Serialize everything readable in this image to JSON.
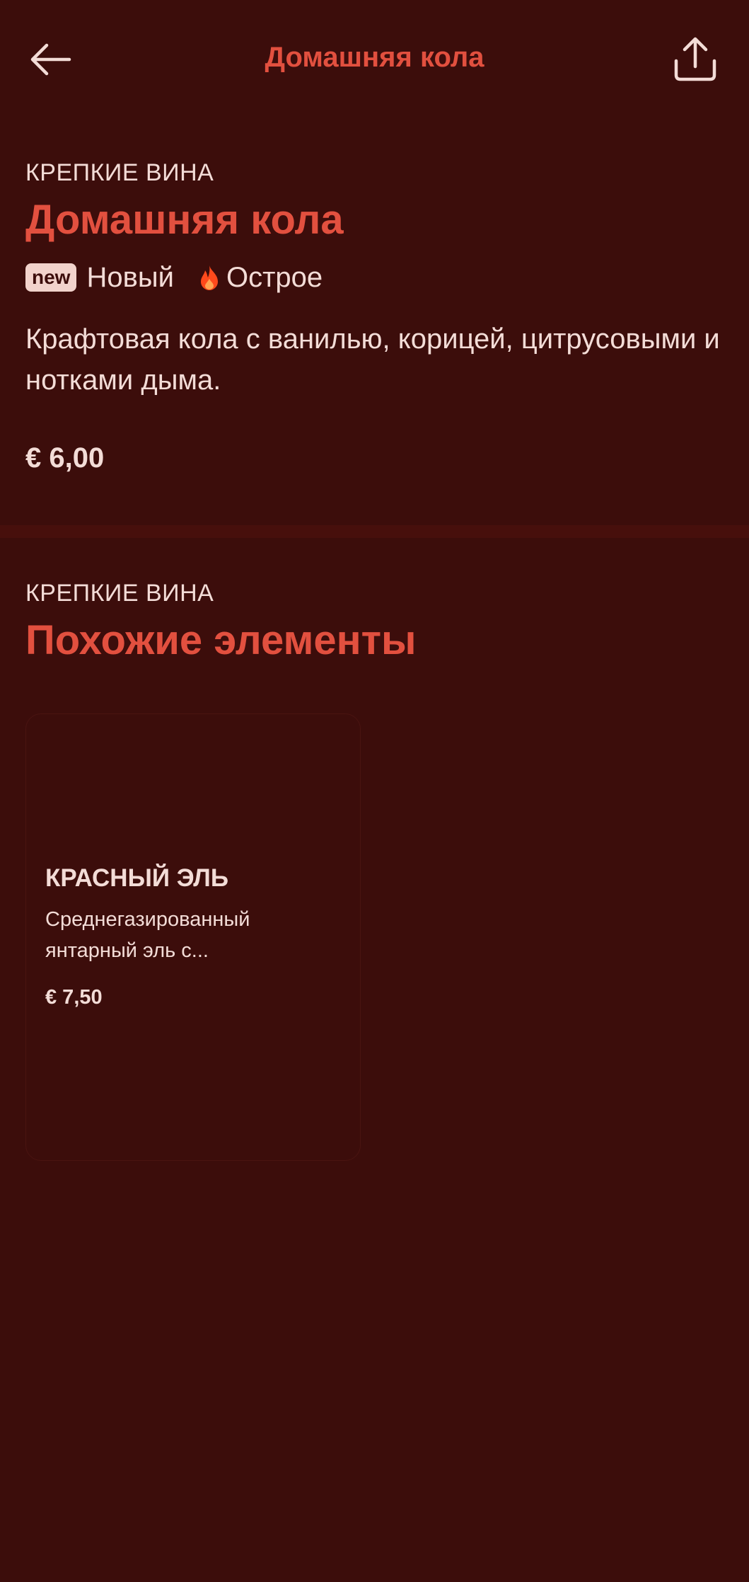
{
  "header": {
    "title": "Домашняя кола",
    "back_icon": "arrow-left-icon",
    "share_icon": "share-icon"
  },
  "item": {
    "category": "КРЕПКИЕ ВИНА",
    "title": "Домашняя кола",
    "badge": "new",
    "new_label": "Новый",
    "spicy_icon": "flame-icon",
    "spicy_label": "Острое",
    "description": "Крафтовая кола с ванилью, корицей, цитрусовыми и нотками дыма.",
    "price": "€ 6,00"
  },
  "similar": {
    "category": "КРЕПКИЕ ВИНА",
    "title": "Похожие элементы",
    "items": [
      {
        "title": "КРАСНЫЙ ЭЛЬ",
        "description": "Среднегазированный янтарный эль с...",
        "price": "€ 7,50"
      }
    ]
  },
  "colors": {
    "background": "#3c0d0b",
    "accent": "#e2503f",
    "text": "#f3dcd7",
    "flame": "#ff4a1c"
  }
}
